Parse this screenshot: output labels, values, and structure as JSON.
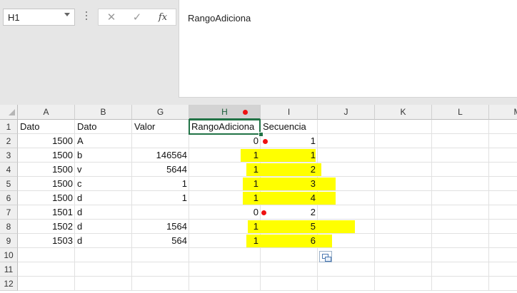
{
  "formula_bar": {
    "name_box": "H1",
    "cancel_glyph": "✕",
    "enter_glyph": "✓",
    "fx_glyph": "fx",
    "formula": "RangoAdiciona"
  },
  "columns": [
    "A",
    "B",
    "G",
    "H",
    "I",
    "J",
    "K",
    "L",
    "M"
  ],
  "rows": [
    "1",
    "2",
    "3",
    "4",
    "5",
    "6",
    "7",
    "8",
    "9",
    "10",
    "11",
    "12"
  ],
  "headers": {
    "A": "Dato",
    "B": "Dato",
    "G": "Valor",
    "H": "RangoAdiciona",
    "I": "Secuencia"
  },
  "data_rows": [
    {
      "A": "1500",
      "B": "A",
      "G": "",
      "H": "0",
      "I": "1"
    },
    {
      "A": "1500",
      "B": "b",
      "G": "146564",
      "H": "1",
      "I": "1"
    },
    {
      "A": "1500",
      "B": "v",
      "G": "5644",
      "H": "1",
      "I": "2"
    },
    {
      "A": "1500",
      "B": "c",
      "G": "1",
      "H": "1",
      "I": "3"
    },
    {
      "A": "1500",
      "B": "d",
      "G": "1",
      "H": "1",
      "I": "4"
    },
    {
      "A": "1501",
      "B": "d",
      "G": "",
      "H": "0",
      "I": "2"
    },
    {
      "A": "1502",
      "B": "d",
      "G": "1564",
      "H": "1",
      "I": "5"
    },
    {
      "A": "1503",
      "B": "d",
      "G": "564",
      "H": "1",
      "I": "6"
    }
  ],
  "highlight_color": "#ffff00",
  "annotation_dot_color": "#ee1111",
  "active_cell": "H1",
  "icons": {
    "name_box_dropdown": "chevron-down-icon",
    "cancel": "close-icon",
    "enter": "checkmark-icon",
    "insert_function": "fx-icon",
    "paste_options": "paste-options-icon"
  }
}
